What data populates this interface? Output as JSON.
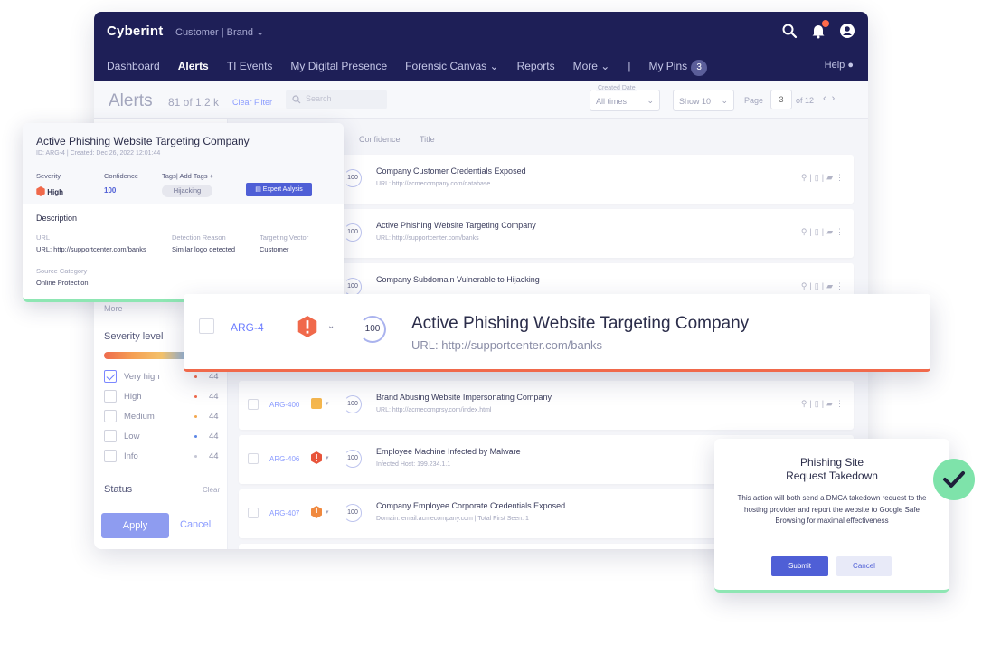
{
  "app": {
    "logo": "Cyberint",
    "context": "Customer  |  Brand  ⌄",
    "help": "Help"
  },
  "nav": [
    {
      "label": "Dashboard"
    },
    {
      "label": "Alerts"
    },
    {
      "label": "TI Events"
    },
    {
      "label": "My Digital Presence"
    },
    {
      "label": "Forensic Canvas ⌄"
    },
    {
      "label": "Reports"
    },
    {
      "label": "More ⌄"
    },
    {
      "label": "|"
    },
    {
      "label": "My Pins"
    }
  ],
  "pins_count": "3",
  "alerts_bar": {
    "title": "Alerts",
    "count": "81 of 1.2 k",
    "clear_filter": "Clear Filter",
    "search_placeholder": "Search",
    "created_label": "Created Date",
    "created_value": "All times",
    "show_value": "Show 10",
    "page_label": "Page",
    "page_value": "3",
    "page_of": "of 12"
  },
  "columns": {
    "confidence": "Confidence",
    "title": "Title"
  },
  "rows": [
    {
      "id": "",
      "title": "Company Customer Credentials Exposed",
      "sub": "URL: http://acmecompany.com/database",
      "conf": "100",
      "sev_color": "#f0694b"
    },
    {
      "id": "",
      "title": "Active Phishing Website Targeting Company",
      "sub": "URL: http://supportcenter.com/banks",
      "conf": "100",
      "sev_color": "#f0694b"
    },
    {
      "id": "",
      "title": "Company Subdomain Vulnerable to Hijacking",
      "sub": "",
      "conf": "100",
      "sev_color": "#f0694b"
    },
    {
      "id": "ARG-400",
      "title": "Brand Abusing Website Impersonating Company",
      "sub": "URL: http://acmecomprsy.com/index.html",
      "conf": "100",
      "sev_color": "#f5b74e"
    },
    {
      "id": "ARG-406",
      "title": "Employee Machine Infected by Malware",
      "sub": "Infected Host: 199.234.1.1",
      "conf": "100",
      "sev_color": "#e8543a"
    },
    {
      "id": "ARG-407",
      "title": "Company Employee Corporate Credentials Exposed",
      "sub": "Domain: email.acmecompany.com | Total First Seen: 1",
      "conf": "100",
      "sev_color": "#f0893f"
    }
  ],
  "sidebar": {
    "more": "More",
    "severity_title": "Severity level",
    "severities": [
      {
        "label": "Very high",
        "count": "44",
        "checked": true,
        "color": "#f0694b"
      },
      {
        "label": "High",
        "count": "44",
        "checked": false,
        "color": "#f0694b"
      },
      {
        "label": "Medium",
        "count": "44",
        "checked": false,
        "color": "#f3a84f"
      },
      {
        "label": "Low",
        "count": "44",
        "checked": false,
        "color": "#5b86e6"
      },
      {
        "label": "Info",
        "count": "44",
        "checked": false,
        "color": "#c4c6d4"
      }
    ],
    "status_title": "Status",
    "status_clear": "Clear",
    "apply": "Apply",
    "cancel": "Cancel"
  },
  "detail": {
    "title": "Active Phishing Website Targeting Company",
    "id_line": "ID: ARG-4 | Created: Dec 26, 2022 12:01:44",
    "severity_label": "Severity",
    "severity_value": "High",
    "confidence_label": "Confidence",
    "confidence_value": "100",
    "tags_label": "Tags| Add Tags +",
    "tag": "Hijacking",
    "expert_button": "Expert Aalysis",
    "description_title": "Description",
    "url_label": "URL",
    "url_value": "URL: http://supportcenter.com/banks",
    "reason_label": "Detection Reason",
    "reason_value": "Similar logo detected",
    "vector_label": "Targeting Vector",
    "vector_value": "Customer",
    "source_label": "Source Category",
    "source_value": "Online Protection"
  },
  "highlight": {
    "id": "ARG-4",
    "confidence": "100",
    "title": "Active Phishing Website Targeting Company",
    "sub": "URL: http://supportcenter.com/banks"
  },
  "takedown": {
    "title_line1": "Phishing Site",
    "title_line2": "Request Takedown",
    "body": "This action will both send a DMCA takedown request to the hosting provider and report the website to Google Safe Browsing for maximal effectiveness",
    "submit": "Submit",
    "cancel": "Cancel"
  },
  "colors": {
    "nav_bg": "#1e1f57",
    "accent": "#4f5fd6",
    "danger": "#f0694b",
    "success": "#7ee3aa"
  },
  "icons": [
    "search-icon",
    "bell-icon",
    "user-icon",
    "help-icon",
    "check-icon",
    "severity-icon",
    "confidence-icon"
  ]
}
